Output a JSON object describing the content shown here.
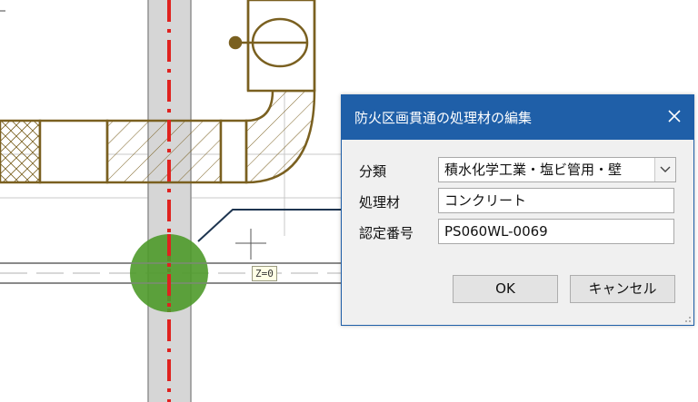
{
  "canvas": {
    "z_label": "Z=0",
    "colors": {
      "background": "#ffffff",
      "pipe_outline": "#7a6020",
      "centerline": "#e0221f",
      "treatment_marker": "#4e9a2a",
      "leader_line": "#1e3550"
    }
  },
  "dialog": {
    "title": "防火区画貫通の処理材の編集",
    "close_icon": "close-icon",
    "fields": {
      "category_label": "分類",
      "category_value": "積水化学工業・塩ビ管用・壁",
      "material_label": "処理材",
      "material_value": "コンクリート",
      "cert_label": "認定番号",
      "cert_value": "PS060WL-0069"
    },
    "buttons": {
      "ok": "OK",
      "cancel": "キャンセル"
    },
    "colors": {
      "titlebar": "#1f5fa8",
      "body": "#f0f0f0"
    }
  }
}
